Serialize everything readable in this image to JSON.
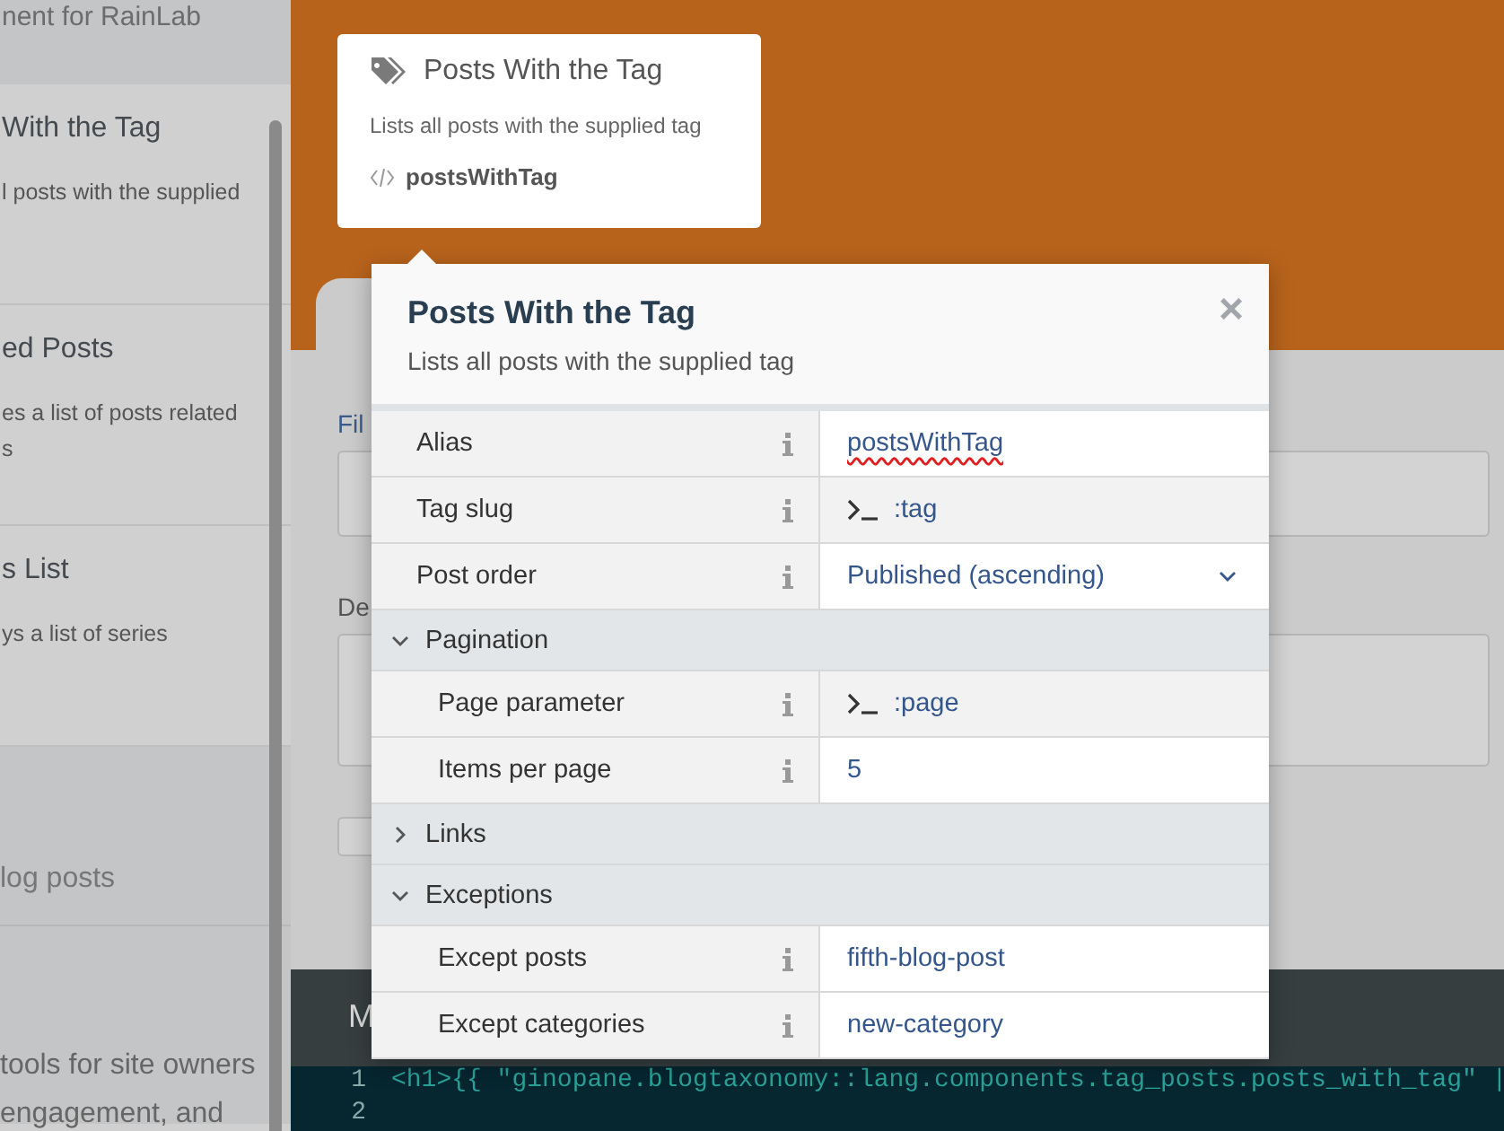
{
  "sidebar": {
    "header": "nent for RainLab",
    "components": [
      {
        "title": "With the Tag",
        "description": [
          "l posts with the supplied"
        ]
      },
      {
        "title": "ed Posts",
        "description": [
          "es a list of posts related",
          "s"
        ]
      },
      {
        "title": "s List",
        "description": [
          "ys a list of series"
        ]
      }
    ],
    "plugins": [
      {
        "title": "log posts"
      },
      {
        "lines": [
          "tools for site owners",
          "engagement, and"
        ]
      }
    ]
  },
  "workspace": {
    "component_card": {
      "title": "Posts With the Tag",
      "description": "Lists all posts with the supplied tag",
      "alias": "postsWithTag"
    },
    "form_labels": [
      "Fil",
      "De"
    ],
    "editor": {
      "tab": "M",
      "lines": [
        {
          "number": "1",
          "code": "<h1>{{ \"ginopane.blogtaxonomy::lang.components.tag_posts.posts_with_tag\" |"
        },
        {
          "number": "2"
        }
      ]
    }
  },
  "inspector": {
    "title": "Posts With the Tag",
    "description": "Lists all posts with the supplied tag",
    "close": "×",
    "properties": [
      {
        "kind": "text",
        "label": "Alias",
        "value": "postsWithTag"
      },
      {
        "kind": "param",
        "label": "Tag slug",
        "value": ":tag"
      },
      {
        "kind": "dropdown",
        "label": "Post order",
        "value": "Published (ascending)"
      },
      {
        "kind": "group",
        "label": "Pagination",
        "expanded": true,
        "children": [
          {
            "kind": "param",
            "label": "Page parameter",
            "value": ":page"
          },
          {
            "kind": "text",
            "label": "Items per page",
            "value": "5"
          }
        ]
      },
      {
        "kind": "group",
        "label": "Links",
        "expanded": false
      },
      {
        "kind": "group",
        "label": "Exceptions",
        "expanded": true,
        "children": [
          {
            "kind": "text",
            "label": "Except posts",
            "value": "fifth-blog-post"
          },
          {
            "kind": "text",
            "label": "Except categories",
            "value": "new-category"
          }
        ]
      }
    ]
  }
}
